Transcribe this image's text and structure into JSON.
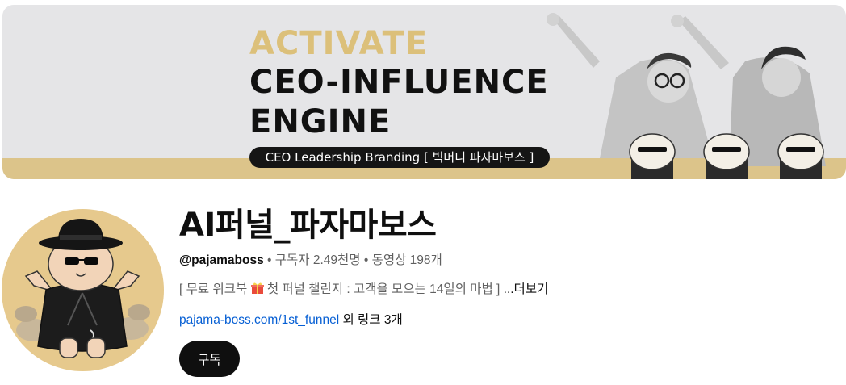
{
  "banner": {
    "activate": "ACTIVATE",
    "headline_line1": "CEO-INFLUENCE",
    "headline_line2": "ENGINE",
    "pill_text": "CEO Leadership Branding [ 빅머니 파자마보스 ]",
    "accent_color": "#dcc48a"
  },
  "channel": {
    "name": "AI퍼널_파자마보스",
    "handle": "@pajamaboss",
    "separator": " • ",
    "subscribers": "구독자 2.49천명",
    "videos": "동영상 198개",
    "description_prefix": "[ 무료 워크북",
    "description_icon": "gift-icon",
    "description_suffix": " 첫 퍼널 챌린지 : 고객을 모으는 14일의 마법 ] ",
    "more_label": "...더보기",
    "link_text": "pajama-boss.com/1st_funnel",
    "link_extra": " 외 링크 3개"
  },
  "actions": {
    "subscribe_label": "구독"
  }
}
